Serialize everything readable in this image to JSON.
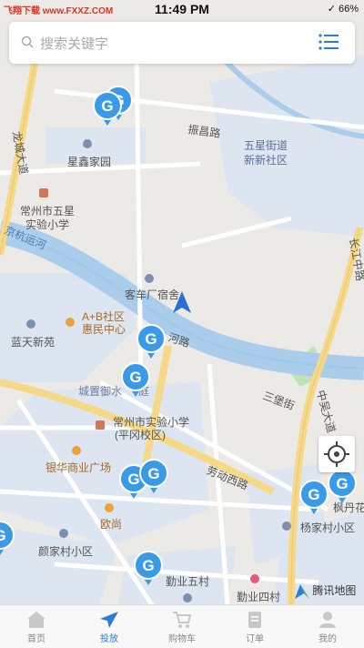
{
  "status_bar": {
    "carrier": "飞翔下载 www.FXXZ.COM",
    "time": "11:49 PM",
    "right": "✓ 66%"
  },
  "search": {
    "placeholder": "搜索关键字",
    "icon": "search-icon",
    "menu_icon": "list-menu-icon"
  },
  "map": {
    "labels": {
      "zhenchang_road": "振昌路",
      "longcheng_ave": "龙城大道",
      "wuxing_jiedao": "五星街道",
      "xinxin_shequ": "新新社区",
      "xingxin_jiayuan": "星鑫家园",
      "changzhou_wuxing_1": "常州市五星",
      "changzhou_wuxing_2": "实验小学",
      "jinghang_canal": "京杭运河",
      "depot_dorm": "客车厂宿舍",
      "ab_community_1": "A+B社区",
      "ab_community_2": "惠民中心",
      "lantian_xinyuan": "蓝天新苑",
      "chengzhi": "城置御水",
      "chengzhi_suffix": "庭",
      "shiyan_xiaoxue_1": "常州市实验小学",
      "shiyan_xiaoxue_2": "(平冈校区)",
      "yinhua_plaza": "银华商业广场",
      "laodong_west": "劳动西路",
      "oushang": "欧尚",
      "yanjiacun": "颜家村小区",
      "yangjiacun": "杨家村小区",
      "qinye_5": "勤业五村",
      "qinye_4": "勤业四村",
      "fengdanhua": "枫丹花",
      "sanbao_st": "三堡街",
      "zhongwu_ave": "中吴大道",
      "changjiang_rd": "长江中路",
      "changhe_rd": "河路"
    },
    "attribution": "腾讯地图",
    "user_location_icon": "navigation-arrow-icon"
  },
  "markers": {
    "letter": "G"
  },
  "tabbar": {
    "items": [
      {
        "label": "首页",
        "icon": "home-icon"
      },
      {
        "label": "投放",
        "icon": "send-icon"
      },
      {
        "label": "购物车",
        "icon": "cart-icon"
      },
      {
        "label": "订单",
        "icon": "order-icon"
      },
      {
        "label": "我的",
        "icon": "profile-icon"
      }
    ],
    "active_index": 1
  },
  "colors": {
    "accent": "#2a7ed8",
    "marker": "#3a9ae8",
    "water": "#a9cdea",
    "road": "#ffffff",
    "major_road": "#f5d987"
  }
}
